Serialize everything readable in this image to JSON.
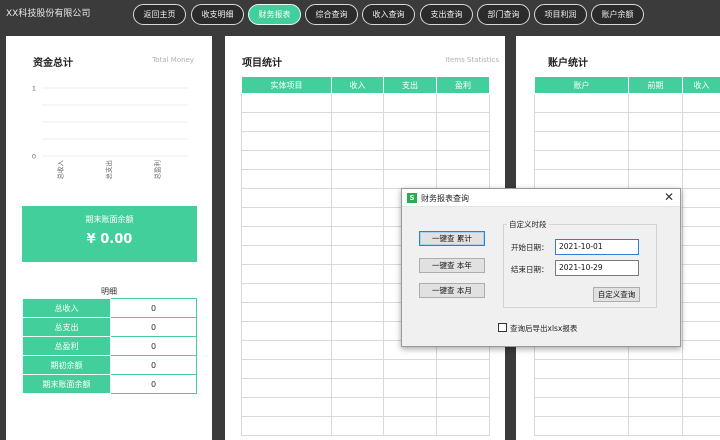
{
  "app": {
    "company": "XX科技股份有限公司"
  },
  "nav": [
    {
      "label": "返回主页",
      "active": false
    },
    {
      "label": "收支明细",
      "active": false
    },
    {
      "label": "财务报表",
      "active": true
    },
    {
      "label": "综合查询",
      "active": false
    },
    {
      "label": "收入查询",
      "active": false
    },
    {
      "label": "支出查询",
      "active": false
    },
    {
      "label": "部门查询",
      "active": false
    },
    {
      "label": "项目利润",
      "active": false
    },
    {
      "label": "账户余额",
      "active": false
    }
  ],
  "fund_panel": {
    "title": "资金总计",
    "subtitle": "Total Money",
    "chart_data": {
      "type": "bar",
      "categories": [
        "总收入",
        "总支出",
        "总盈利"
      ],
      "values": [
        0,
        0,
        0
      ],
      "ylim": [
        0,
        1
      ],
      "yticks": [
        "0",
        "0.25",
        "0.5",
        "0.75",
        "1"
      ],
      "ytick_labels_visible": [
        "0",
        "",
        "",
        "",
        "1"
      ],
      "grid": true
    },
    "balance_label": "期末账面余额",
    "balance_value": "¥ 0.00",
    "detail_title": "明细",
    "detail_rows": [
      {
        "label": "总收入",
        "value": "0"
      },
      {
        "label": "总支出",
        "value": "0"
      },
      {
        "label": "总盈利",
        "value": "0"
      },
      {
        "label": "期初余额",
        "value": "0"
      },
      {
        "label": "期末账面余额",
        "value": "0"
      }
    ]
  },
  "items_panel": {
    "title": "项目统计",
    "subtitle": "Items Statistics",
    "columns": [
      "实体项目",
      "收入",
      "支出",
      "盈利"
    ]
  },
  "account_panel": {
    "title": "账户统计",
    "columns": [
      "账户",
      "前期",
      "收入"
    ]
  },
  "dialog": {
    "title": "财务报表查询",
    "icon_letter": "S",
    "close_glyph": "✕",
    "buttons": [
      {
        "label": "一键查  累计",
        "focused": true
      },
      {
        "label": "一键查  本年",
        "focused": false
      },
      {
        "label": "一键查  本月",
        "focused": false
      }
    ],
    "group_label": "自定义时段",
    "start_label": "开始日期：",
    "start_value": "2021-10-01",
    "end_label": "结束日期：",
    "end_value": "2021-10-29",
    "custom_query_label": "自定义查询",
    "export_label": "查询后导出xlsx报表",
    "export_checked": false
  },
  "colors": {
    "accent": "#43cf9c",
    "background": "#3b3b3b"
  }
}
